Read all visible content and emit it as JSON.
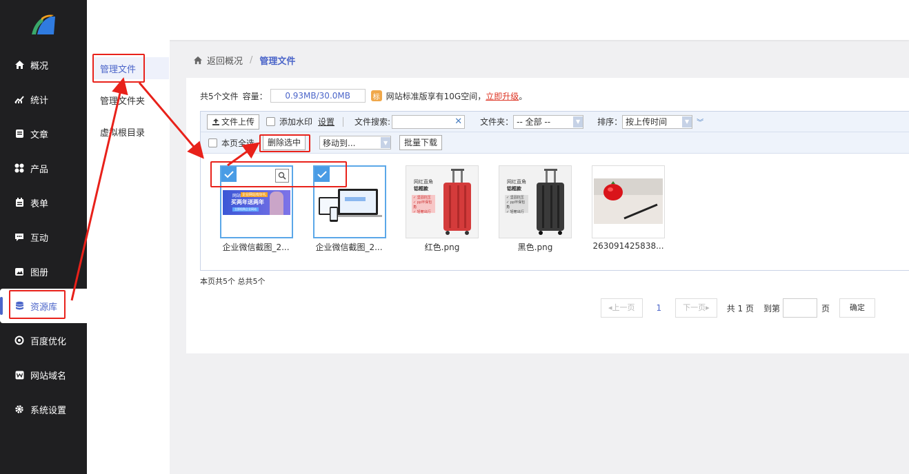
{
  "sidebar": {
    "items": [
      {
        "label": "概况",
        "icon": "home-icon"
      },
      {
        "label": "统计",
        "icon": "chart-icon"
      },
      {
        "label": "文章",
        "icon": "article-icon"
      },
      {
        "label": "产品",
        "icon": "grid-icon"
      },
      {
        "label": "表单",
        "icon": "form-icon"
      },
      {
        "label": "互动",
        "icon": "chat-icon"
      },
      {
        "label": "图册",
        "icon": "album-icon"
      },
      {
        "label": "资源库",
        "icon": "database-icon"
      },
      {
        "label": "百度优化",
        "icon": "seo-icon"
      },
      {
        "label": "网站域名",
        "icon": "domain-icon"
      },
      {
        "label": "系统设置",
        "icon": "gear-icon"
      }
    ]
  },
  "subnav": {
    "items": [
      "管理文件",
      "管理文件夹",
      "虚拟根目录"
    ]
  },
  "breadcrumb": {
    "back": "返回概况",
    "sep": "/",
    "current": "管理文件"
  },
  "usage": {
    "count_label": "共5个文件",
    "capacity_label": "容量：",
    "capacity_value": "0.93MB/30.0MB",
    "badge": "标",
    "upgrade_text": "网站标准版享有10G空间，",
    "upgrade_link": "立即升级",
    "end": "。"
  },
  "toolbar": {
    "upload": "文件上传",
    "watermark": "添加水印",
    "settings": "设置",
    "search_label": "文件搜索:",
    "folder_label": "文件夹：",
    "folder_value": "-- 全部 --",
    "sort_label": "排序：",
    "sort_value": "按上传时间",
    "select_all": "本页全选",
    "delete_selected": "删除选中",
    "move_to": "移动到...",
    "batch_download": "批量下载"
  },
  "files": [
    {
      "name": "企业微信截图_2...",
      "selected": true
    },
    {
      "name": "企业微信截图_2...",
      "selected": true
    },
    {
      "name": "红色.png",
      "selected": false
    },
    {
      "name": "黑色.png",
      "selected": false
    },
    {
      "name": "263091425838...",
      "selected": false
    }
  ],
  "thumb_text": {
    "banner_tag": "网站",
    "banner_line": "买两年送两年",
    "banner_small": "企业网站有好礼",
    "banner_button": "立即抢购企业网站",
    "case_title": "网红直角",
    "case_sub": "铝框款",
    "case_feat1": "✓ 坚固抗压",
    "case_feat2": "✓ pp环保包角",
    "case_feat3": "✓ 轻奢出行"
  },
  "summary": "本页共5个 总共5个",
  "pager": {
    "prev": "上一页",
    "page": "1",
    "next": "下一页",
    "total": "共 1 页",
    "goto": "到第",
    "page_unit": "页",
    "confirm": "确定"
  },
  "colors": {
    "accent": "#4b65c9",
    "sidebar_bg": "#1f1f21",
    "annotation": "#e8211a",
    "select_blue": "#4a9ce5"
  }
}
